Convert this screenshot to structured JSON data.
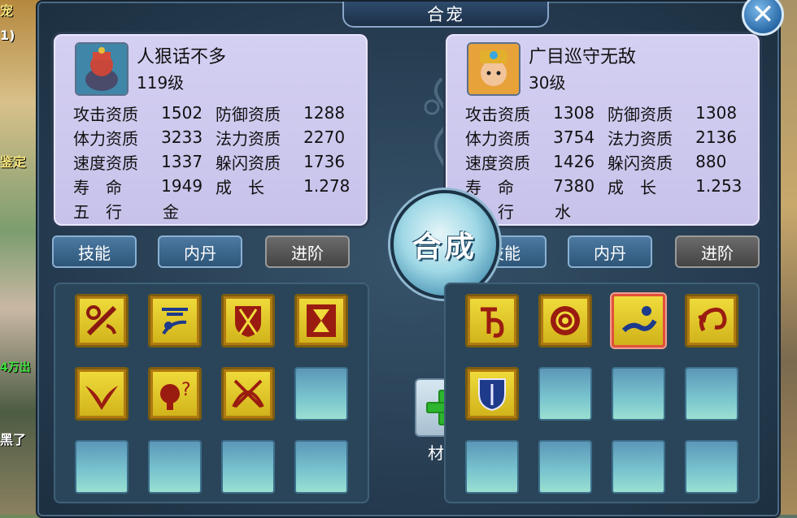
{
  "window": {
    "title": "合宠"
  },
  "background": {
    "left_texts": [
      "宠",
      "1)",
      "鉴定",
      "4万出",
      "黑了"
    ]
  },
  "left_pet": {
    "name": "人狠话不多",
    "level": "119级",
    "stats": [
      [
        "攻击资质",
        "1502",
        "防御资质",
        "1288"
      ],
      [
        "体力资质",
        "3233",
        "法力资质",
        "2270"
      ],
      [
        "速度资质",
        "1337",
        "躲闪资质",
        "1736"
      ],
      [
        "寿　命",
        "1949",
        "成　长",
        "1.278"
      ],
      [
        "五　行",
        "金",
        "",
        ""
      ]
    ],
    "tabs": [
      "技能",
      "内丹",
      "进阶"
    ],
    "skills": [
      "staff-skill-icon",
      "wind-skill-icon",
      "shield-sword-skill-icon",
      "hourglass-skill-icon",
      "eagle-skill-icon",
      "question-skill-icon",
      "crossed-blades-skill-icon"
    ]
  },
  "right_pet": {
    "name": "广目巡守无敌",
    "level": "30级",
    "stats": [
      [
        "攻击资质",
        "1308",
        "防御资质",
        "1308"
      ],
      [
        "体力资质",
        "3754",
        "法力资质",
        "2136"
      ],
      [
        "速度资质",
        "1426",
        "躲闪资质",
        "880"
      ],
      [
        "寿　命",
        "7380",
        "成　长",
        "1.253"
      ],
      [
        "五　行",
        "水",
        "",
        ""
      ]
    ],
    "tabs": [
      "技能",
      "内丹",
      "进阶"
    ],
    "skills": [
      "rune-skill-icon",
      "mandala-skill-icon",
      "dragon-skill-icon",
      "spiral-skill-icon",
      "blue-shield-skill-icon"
    ]
  },
  "center": {
    "fuse_label": "合成",
    "material_label": "材料"
  },
  "colors": {
    "skill_gold": "#e8cc2c",
    "panel_lilac": "#cfcaf0",
    "accent_blue": "#2d5578"
  }
}
